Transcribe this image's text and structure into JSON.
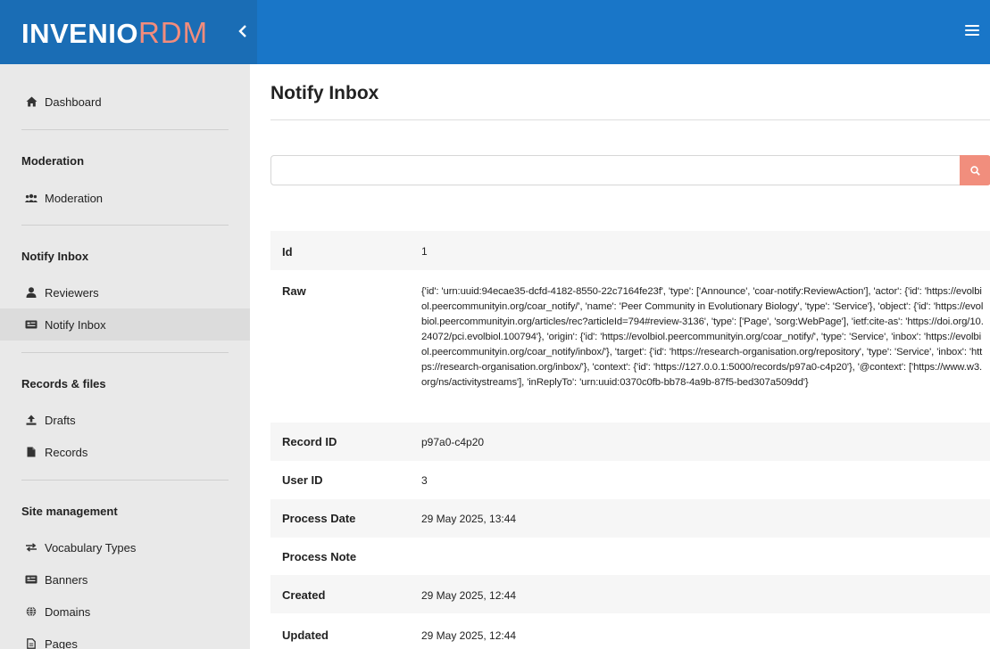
{
  "app": {
    "logo_main": "INVENIO",
    "logo_accent": "RDM"
  },
  "sidebar": {
    "dashboard": "Dashboard",
    "sections": [
      {
        "title": "Moderation",
        "items": [
          "Moderation"
        ]
      },
      {
        "title": "Notify Inbox",
        "items": [
          "Reviewers",
          "Notify Inbox"
        ]
      },
      {
        "title": "Records & files",
        "items": [
          "Drafts",
          "Records"
        ]
      },
      {
        "title": "Site management",
        "items": [
          "Vocabulary Types",
          "Banners",
          "Domains",
          "Pages"
        ]
      }
    ],
    "active_item": "Notify Inbox"
  },
  "page": {
    "title": "Notify Inbox"
  },
  "search": {
    "placeholder": "",
    "value": ""
  },
  "detail": {
    "id_label": "Id",
    "id_value": "1",
    "raw_label": "Raw",
    "raw_value": "{'id': 'urn:uuid:94ecae35-dcfd-4182-8550-22c7164fe23f', 'type': ['Announce', 'coar-notify:ReviewAction'], 'actor': {'id': 'https://evolbiol.peercommunityin.org/coar_notify/', 'name': 'Peer Community in Evolutionary Biology', 'type': 'Service'}, 'object': {'id': 'https://evolbiol.peercommunityin.org/articles/rec?articleId=794#review-3136', 'type': ['Page', 'sorg:WebPage'], 'ietf:cite-as': 'https://doi.org/10.24072/pci.evolbiol.100794'}, 'origin': {'id': 'https://evolbiol.peercommunityin.org/coar_notify/', 'type': 'Service', 'inbox': 'https://evolbiol.peercommunityin.org/coar_notify/inbox/'}, 'target': {'id': 'https://research-organisation.org/repository', 'type': 'Service', 'inbox': 'https://research-organisation.org/inbox/'}, 'context': {'id': 'https://127.0.0.1:5000/records/p97a0-c4p20'}, '@context': ['https://www.w3.org/ns/activitystreams'], 'inReplyTo': 'urn:uuid:0370c0fb-bb78-4a9b-87f5-bed307a509dd'}",
    "record_id_label": "Record ID",
    "record_id_value": "p97a0-c4p20",
    "user_id_label": "User ID",
    "user_id_value": "3",
    "process_date_label": "Process Date",
    "process_date_value": "29 May 2025, 13:44",
    "process_note_label": "Process Note",
    "process_note_value": "",
    "created_label": "Created",
    "created_value": "29 May 2025, 12:44",
    "updated_label": "Updated",
    "updated_value": "29 May 2025, 12:44"
  },
  "colors": {
    "topbar": "#1976c8",
    "brand": "#1a6db5",
    "accent": "#f18e7d",
    "sidebar_bg": "#e9e9e9",
    "link": "#1a6db5"
  },
  "icons": {
    "dashboard": "home-icon",
    "moderation": "users-icon",
    "reviewers": "user-icon",
    "notify_inbox": "inbox-card-icon",
    "drafts": "upload-icon",
    "records": "file-icon",
    "vocabulary_types": "exchange-icon",
    "banners": "banner-card-icon",
    "domains": "globe-icon",
    "pages": "page-icon",
    "search": "search-icon",
    "menu": "hamburger-icon",
    "collapse": "chevron-left-icon"
  }
}
